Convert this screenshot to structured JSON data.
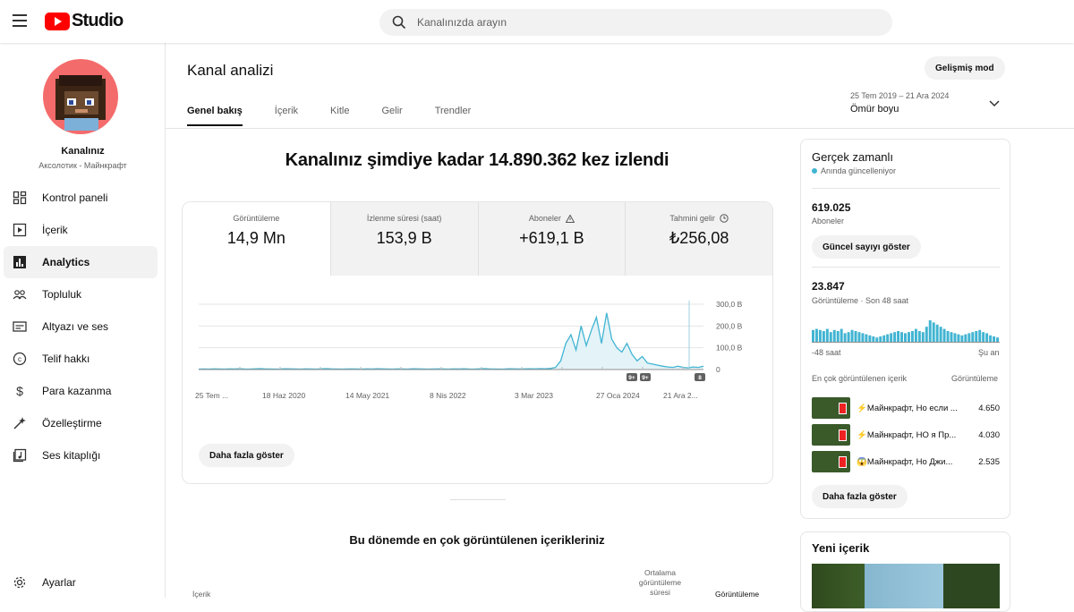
{
  "header": {
    "logo_text": "Studio",
    "search_placeholder": "Kanalınızda arayın"
  },
  "channel": {
    "name": "Kanalınız",
    "subtitle": "Аксолотик - Майнкрафт"
  },
  "nav": [
    {
      "label": "Kontrol paneli",
      "icon": "dashboard-icon"
    },
    {
      "label": "İçerik",
      "icon": "content-icon"
    },
    {
      "label": "Analytics",
      "icon": "analytics-icon",
      "active": true
    },
    {
      "label": "Topluluk",
      "icon": "community-icon"
    },
    {
      "label": "Altyazı ve ses",
      "icon": "subtitles-icon"
    },
    {
      "label": "Telif hakkı",
      "icon": "copyright-icon"
    },
    {
      "label": "Para kazanma",
      "icon": "dollar-icon"
    },
    {
      "label": "Özelleştirme",
      "icon": "magic-wand-icon"
    },
    {
      "label": "Ses kitaplığı",
      "icon": "audio-library-icon"
    }
  ],
  "settings_label": "Ayarlar",
  "page": {
    "title": "Kanal analizi",
    "advanced_button": "Gelişmiş mod",
    "tabs": [
      "Genel bakış",
      "İçerik",
      "Kitle",
      "Gelir",
      "Trendler"
    ],
    "date_range": "25 Tem 2019 – 21 Ara 2024",
    "date_label": "Ömür boyu",
    "headline": "Kanalınız şimdiye kadar 14.890.362 kez izlendi",
    "more_button": "Daha fazla göster",
    "top_content_title": "Bu dönemde en çok görüntülenen içerikleriniz",
    "table_headers": {
      "content": "İçerik",
      "avg_view": "Ortalama görüntüleme süresi",
      "views": "Görüntüleme"
    }
  },
  "metrics": [
    {
      "label": "Görüntüleme",
      "value": "14,9 Mn"
    },
    {
      "label": "İzlenme süresi (saat)",
      "value": "153,9 B"
    },
    {
      "label": "Aboneler",
      "value": "+619,1 B"
    },
    {
      "label": "Tahmini gelir",
      "value": "₺256,08"
    }
  ],
  "chart_data": {
    "type": "line",
    "x_labels": [
      "25 Tem ...",
      "18 Haz 2020",
      "14 May 2021",
      "8 Nis 2022",
      "3 Mar 2023",
      "27 Oca 2024",
      "21 Ara 2..."
    ],
    "y_ticks": [
      "300,0 B",
      "200,0 B",
      "100,0 B",
      "0"
    ],
    "ylim": [
      0,
      300000
    ],
    "markers": [
      "9+",
      "9+",
      "8"
    ],
    "series": [
      {
        "values": [
          2000,
          2500,
          2000,
          3000,
          2500,
          2000,
          3000,
          2500,
          3500,
          2500,
          2000,
          3000,
          4000,
          3000,
          2500,
          2000,
          2500,
          3500,
          3000,
          2500,
          2000,
          3000,
          2500,
          2000,
          3000,
          4000,
          3000,
          2500,
          2000,
          2500,
          3000,
          2500,
          2000,
          3000,
          2500,
          3500,
          3000,
          2500,
          2000,
          3000,
          2500,
          2000,
          3500,
          3000,
          2500,
          2000,
          2500,
          3000,
          2500,
          2000,
          3000,
          2500,
          3500,
          2500,
          2000,
          3000,
          4000,
          3000,
          2500,
          2000,
          2500,
          3500,
          3000,
          2500,
          3000,
          3500,
          3000,
          4000,
          3500,
          5000,
          10000,
          40000,
          120000,
          160000,
          90000,
          200000,
          110000,
          180000,
          240000,
          120000,
          260000,
          140000,
          100000,
          80000,
          120000,
          70000,
          40000,
          60000,
          30000,
          25000,
          20000,
          15000,
          12000,
          10000,
          15000,
          10000,
          8000,
          12000,
          10000,
          15000
        ]
      }
    ]
  },
  "realtime": {
    "title": "Gerçek zamanlı",
    "subtitle": "Anında güncelleniyor",
    "subscribers": "619.025",
    "subscribers_label": "Aboneler",
    "live_button": "Güncel sayıyı göster",
    "views": "23.847",
    "views_label": "Görüntüleme · Son 48 saat",
    "left_label": "-48 saat",
    "right_label": "Şu an",
    "bars": [
      11,
      12,
      11,
      10,
      12,
      9,
      11,
      10,
      12,
      8,
      9,
      11,
      10,
      9,
      8,
      7,
      6,
      5,
      4,
      5,
      6,
      7,
      8,
      9,
      10,
      9,
      8,
      9,
      10,
      12,
      10,
      9,
      14,
      20,
      18,
      16,
      14,
      12,
      10,
      9,
      8,
      7,
      6,
      7,
      8,
      9,
      10,
      11,
      9,
      8,
      6,
      5,
      4
    ],
    "top_header": "En çok görüntülenen içerik",
    "top_header_right": "Görüntüleme",
    "videos": [
      {
        "title": "⚡Майнкрафт, Но если ...",
        "count": "4.650"
      },
      {
        "title": "⚡Майнкрафт, НО я Пр...",
        "count": "4.030"
      },
      {
        "title": "😱Майнкрафт, Но Джи...",
        "count": "2.535"
      }
    ],
    "more_button": "Daha fazla göster"
  },
  "new_content": {
    "title": "Yeni içerik"
  },
  "colors": {
    "accent": "#41b4d2",
    "brand": "#ff0000"
  }
}
